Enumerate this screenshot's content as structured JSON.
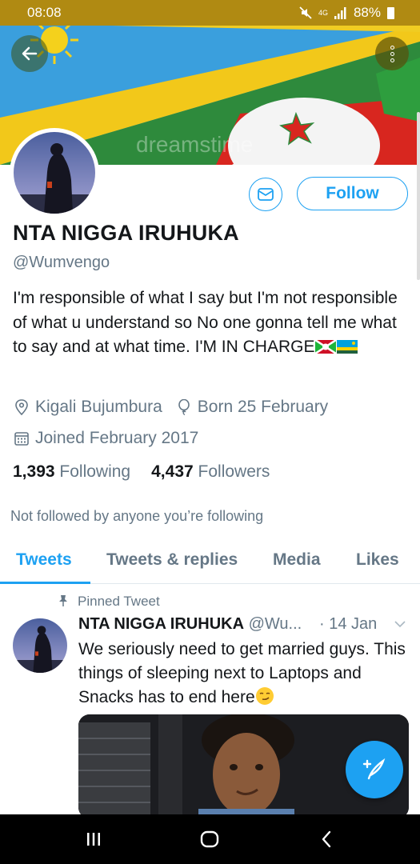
{
  "status_bar": {
    "time": "08:08",
    "signal_label": "4G",
    "battery": "88%"
  },
  "header": {
    "back_icon": "arrow-left-icon",
    "more_icon": "more-vertical-icon",
    "banner_watermark": "dreamstime"
  },
  "profile": {
    "name": "NTA NIGGA IRUHUKA",
    "handle": "@Wumvengo",
    "bio": "I'm responsible of what I say but I'm not responsible of what u understand so No one gonna tell me what to say and at what time.  I'M IN CHARGE",
    "location": "Kigali Bujumbura",
    "birthday": "Born 25 February",
    "joined": "Joined February 2017",
    "following_count": "1,393",
    "following_label": "Following",
    "followers_count": "4,437",
    "followers_label": "Followers",
    "not_followed": "Not followed by anyone you’re following",
    "follow_button": "Follow",
    "message_icon": "envelope-icon"
  },
  "tabs": [
    {
      "label": "Tweets",
      "active": true
    },
    {
      "label": "Tweets & replies",
      "active": false
    },
    {
      "label": "Media",
      "active": false
    },
    {
      "label": "Likes",
      "active": false
    }
  ],
  "tweet": {
    "pinned_label": "Pinned Tweet",
    "author_name": "NTA NIGGA IRUHUKA",
    "author_handle": "@Wu...",
    "date": "· 14 Jan",
    "text": "We seriously need to get married guys. This things of sleeping next to Laptops and Snacks has to end here"
  },
  "colors": {
    "accent": "#1da1f2",
    "secondary_text": "#657786",
    "status_bar": "#b08a12"
  },
  "fab_icon": "compose-feather-icon",
  "nav": {
    "recents_icon": "recents-icon",
    "home_icon": "home-icon",
    "back_icon": "nav-back-icon"
  }
}
